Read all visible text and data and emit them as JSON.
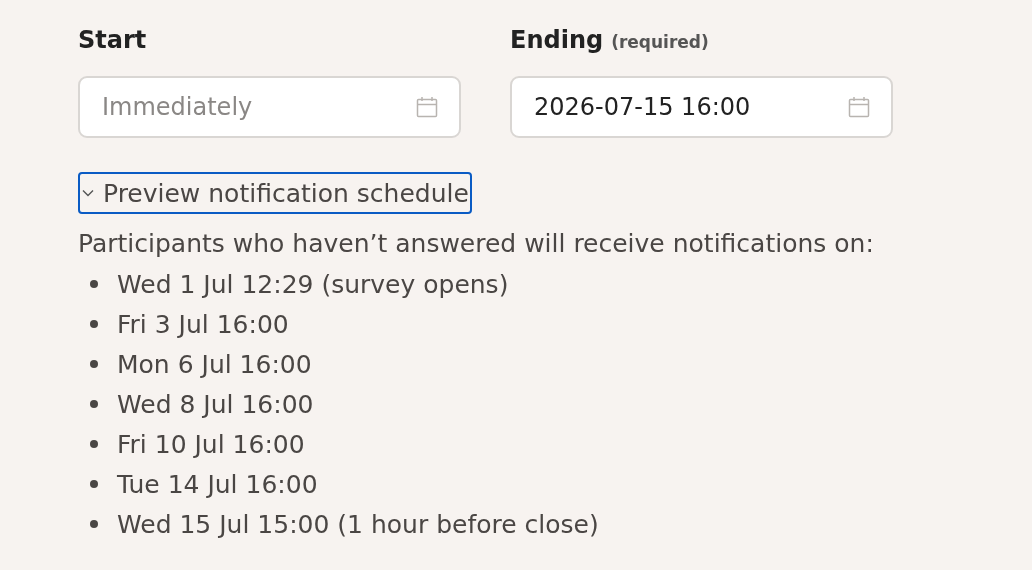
{
  "fields": [
    {
      "label": "Start",
      "placeholder": "Immediately"
    },
    {
      "label": "Ending",
      "note": "(required)",
      "value": "2026-07-15 16:00"
    }
  ],
  "preview": {
    "label": "Preview notification schedule",
    "expanded": true,
    "focused": true,
    "intro": "Participants who haven’t answered will receive notifications on:",
    "items": [
      "Wed 1 Jul 12:29 (survey opens)",
      "Fri 3 Jul 16:00",
      "Mon 6 Jul 16:00",
      "Wed 8 Jul 16:00",
      "Fri 10 Jul 16:00",
      "Tue 14 Jul 16:00",
      "Wed 15 Jul 15:00 (1 hour before close)"
    ]
  }
}
